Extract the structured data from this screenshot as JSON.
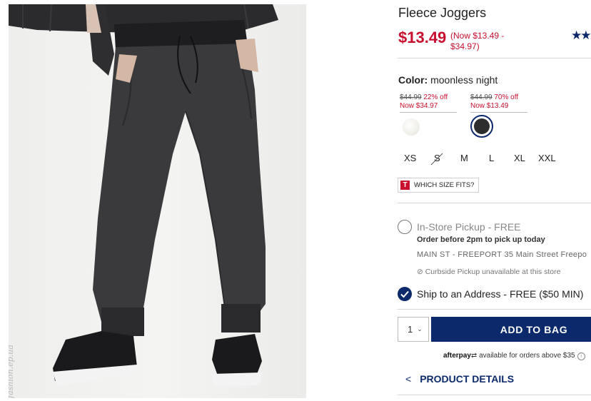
{
  "product": {
    "title": "Fleece Joggers",
    "price": "$13.49",
    "price_range": "(Now $13.49 - $34.97)",
    "stars": "★★"
  },
  "color": {
    "label": "Color:",
    "value": "moonless night",
    "swatches": [
      {
        "was": "$44.99",
        "off": "22% off",
        "now": "Now $34.97",
        "name": "white-swatch"
      },
      {
        "was": "$44.99",
        "off": "70% off",
        "now": "Now $13.49",
        "name": "moonless-night-swatch"
      }
    ]
  },
  "sizes": [
    "XS",
    "S",
    "M",
    "L",
    "XL",
    "XXL"
  ],
  "which_size": "WHICH SIZE FITS?",
  "pickup": {
    "title": "In-Store Pickup - FREE",
    "order": "Order before 2pm to pick up today",
    "store": "MAIN ST - FREEPORT 35 Main Street  Freepo",
    "curbside": "Curbside Pickup unavailable at this store"
  },
  "ship": {
    "label": "Ship to an Address - FREE ($50 MIN)"
  },
  "cart": {
    "qty": "1",
    "add_label": "ADD TO BAG"
  },
  "afterpay": {
    "brand": "afterpay",
    "text": "available for orders above $35"
  },
  "details": {
    "label": "PRODUCT DETAILS"
  },
  "watermark": "fashion.ep.ua",
  "colors": {
    "brand_navy": "#0c2a6b",
    "sale_red": "#c8102e"
  }
}
